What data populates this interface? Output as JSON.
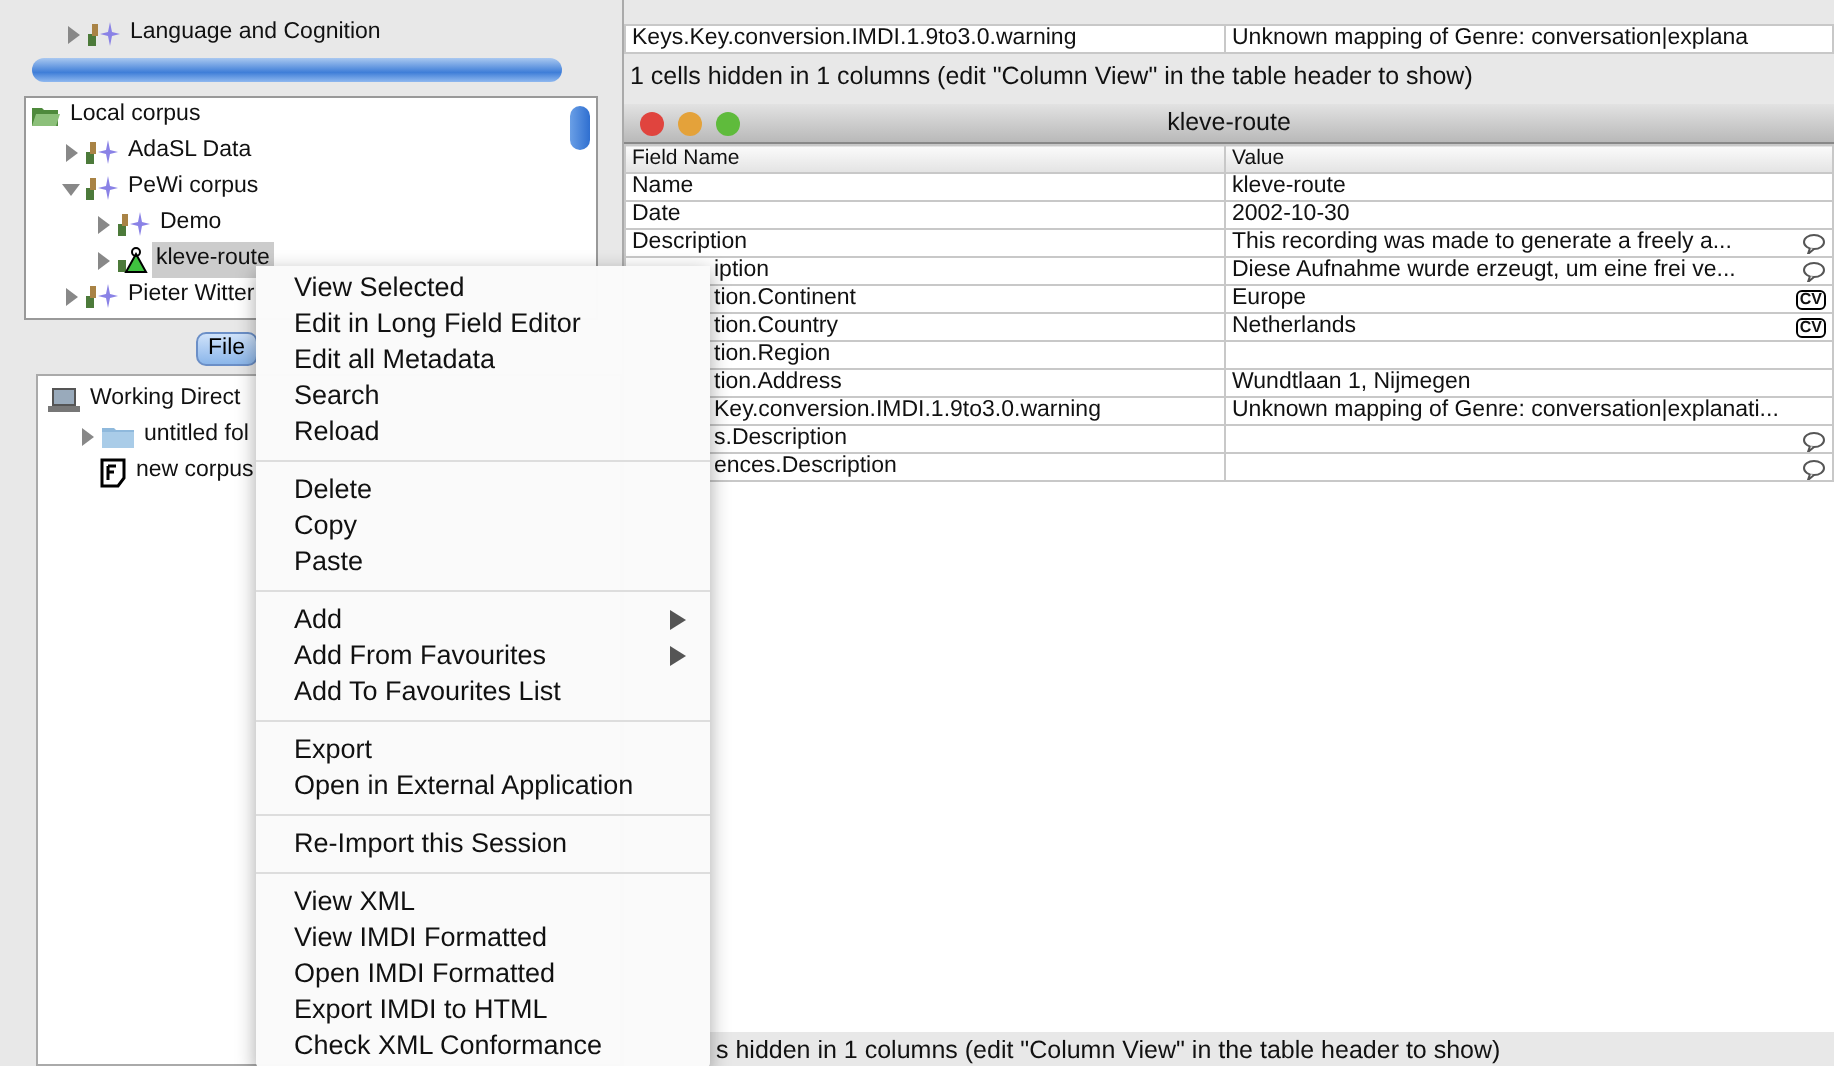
{
  "top_tree": {
    "items": [
      {
        "label": "Language and Cognition",
        "kind": "corpus",
        "expanded": false
      }
    ]
  },
  "top_table": {
    "rows": [
      {
        "field": "Keys.Key.conversion.IMDI.1.9to3.0.warning",
        "value": "Unknown mapping of Genre: conversation|explana"
      }
    ],
    "status": "1 cells hidden in 1 columns (edit \"Column View\" in the table header to show)"
  },
  "local_tree": {
    "items": [
      {
        "label": "Local corpus",
        "kind": "open-folder",
        "selected": false,
        "children": [
          {
            "label": "AdaSL Data",
            "kind": "corpus",
            "expanded": false,
            "selected": false
          },
          {
            "label": "PeWi corpus",
            "kind": "corpus",
            "expanded": true,
            "selected": false,
            "children": [
              {
                "label": "Demo",
                "kind": "corpus",
                "expanded": false,
                "selected": false
              },
              {
                "label": "kleve-route",
                "kind": "session",
                "expanded": false,
                "selected": true
              }
            ]
          },
          {
            "label": "Pieter Witter",
            "kind": "corpus",
            "expanded": false,
            "selected": false
          }
        ]
      }
    ]
  },
  "tabs": [
    {
      "label": "File",
      "selected": true
    }
  ],
  "files_tree": {
    "items": [
      {
        "label": "Working Direct",
        "kind": "computer",
        "children": [
          {
            "label": "untitled fol",
            "kind": "folder",
            "expanded": false
          },
          {
            "label": "new corpus",
            "kind": "file"
          }
        ]
      }
    ]
  },
  "detail_window": {
    "title": "kleve-route",
    "columns": [
      "Field Name",
      "Value"
    ],
    "rows": [
      {
        "field": "Name",
        "value": "kleve-route",
        "kind": "plain",
        "clipped": false
      },
      {
        "field": "Date",
        "value": "2002-10-30",
        "kind": "plain",
        "clipped": false
      },
      {
        "field": "Description",
        "value": "This  recording was made to generate a freely a...",
        "kind": "comment",
        "clipped": false
      },
      {
        "field": "iption",
        "value": "Diese Aufnahme wurde erzeugt, um eine frei ve...",
        "kind": "comment",
        "clipped": true
      },
      {
        "field": "tion.Continent",
        "value": "Europe",
        "kind": "cv",
        "badge": "CV",
        "clipped": true
      },
      {
        "field": "tion.Country",
        "value": "Netherlands",
        "kind": "cv",
        "badge": "CV",
        "clipped": true
      },
      {
        "field": "tion.Region",
        "value": "",
        "kind": "plain",
        "clipped": true
      },
      {
        "field": "tion.Address",
        "value": "Wundtlaan 1, Nijmegen",
        "kind": "plain",
        "clipped": true
      },
      {
        "field": "Key.conversion.IMDI.1.9to3.0.warning",
        "value": "Unknown mapping of Genre: conversation|explanati...",
        "kind": "plain",
        "clipped": true
      },
      {
        "field": "s.Description",
        "value": "",
        "kind": "comment",
        "clipped": true
      },
      {
        "field": "ences.Description",
        "value": "",
        "kind": "comment",
        "clipped": true
      }
    ],
    "status": "s hidden in 1 columns (edit \"Column View\" in the table header to show)"
  },
  "context_menu": {
    "groups": [
      [
        {
          "label": "View Selected"
        },
        {
          "label": "Edit in Long Field Editor"
        },
        {
          "label": "Edit all Metadata"
        },
        {
          "label": "Search"
        },
        {
          "label": "Reload"
        }
      ],
      [
        {
          "label": "Delete"
        },
        {
          "label": "Copy"
        },
        {
          "label": "Paste"
        }
      ],
      [
        {
          "label": "Add",
          "submenu": true
        },
        {
          "label": "Add From Favourites",
          "submenu": true
        },
        {
          "label": "Add To Favourites List"
        }
      ],
      [
        {
          "label": "Export"
        },
        {
          "label": "Open in External Application"
        }
      ],
      [
        {
          "label": "Re-Import this Session"
        }
      ],
      [
        {
          "label": "View XML"
        },
        {
          "label": "View IMDI Formatted"
        },
        {
          "label": "Open IMDI Formatted"
        },
        {
          "label": "Export IMDI to HTML"
        },
        {
          "label": "Check XML Conformance"
        }
      ]
    ]
  }
}
